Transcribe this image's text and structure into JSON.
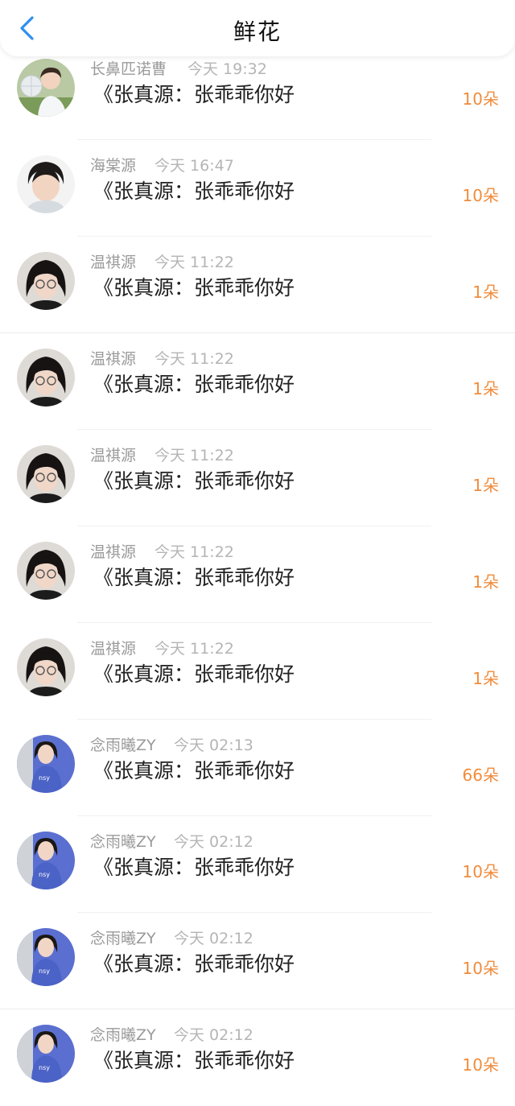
{
  "header": {
    "title": "鲜花",
    "back_icon": "chevron-left-icon",
    "accent_color": "#2e8ff0"
  },
  "colors": {
    "count": "#f08c3c",
    "name": "#9a9a9a",
    "time": "#b5b5b5",
    "message": "#222222"
  },
  "rows": [
    {
      "name": "长鼻匹诺曹",
      "time": "今天 19:32",
      "message": "《张真源：张乖乖你好",
      "count": "10朵",
      "avatar": "avatar-a"
    },
    {
      "name": "海棠源",
      "time": "今天 16:47",
      "message": "《张真源：张乖乖你好",
      "count": "10朵",
      "avatar": "avatar-b"
    },
    {
      "name": "温祺源",
      "time": "今天 11:22",
      "message": "《张真源：张乖乖你好",
      "count": "1朵",
      "avatar": "avatar-c"
    },
    {
      "name": "温祺源",
      "time": "今天 11:22",
      "message": "《张真源：张乖乖你好",
      "count": "1朵",
      "avatar": "avatar-c"
    },
    {
      "name": "温祺源",
      "time": "今天 11:22",
      "message": "《张真源：张乖乖你好",
      "count": "1朵",
      "avatar": "avatar-c"
    },
    {
      "name": "温祺源",
      "time": "今天 11:22",
      "message": "《张真源：张乖乖你好",
      "count": "1朵",
      "avatar": "avatar-c"
    },
    {
      "name": "温祺源",
      "time": "今天 11:22",
      "message": "《张真源：张乖乖你好",
      "count": "1朵",
      "avatar": "avatar-c"
    },
    {
      "name": "念雨曦ZY",
      "time": "今天 02:13",
      "message": "《张真源：张乖乖你好",
      "count": "66朵",
      "avatar": "avatar-d"
    },
    {
      "name": "念雨曦ZY",
      "time": "今天 02:12",
      "message": "《张真源：张乖乖你好",
      "count": "10朵",
      "avatar": "avatar-d"
    },
    {
      "name": "念雨曦ZY",
      "time": "今天 02:12",
      "message": "《张真源：张乖乖你好",
      "count": "10朵",
      "avatar": "avatar-d"
    },
    {
      "name": "念雨曦ZY",
      "time": "今天 02:12",
      "message": "《张真源：张乖乖你好",
      "count": "10朵",
      "avatar": "avatar-d"
    }
  ]
}
